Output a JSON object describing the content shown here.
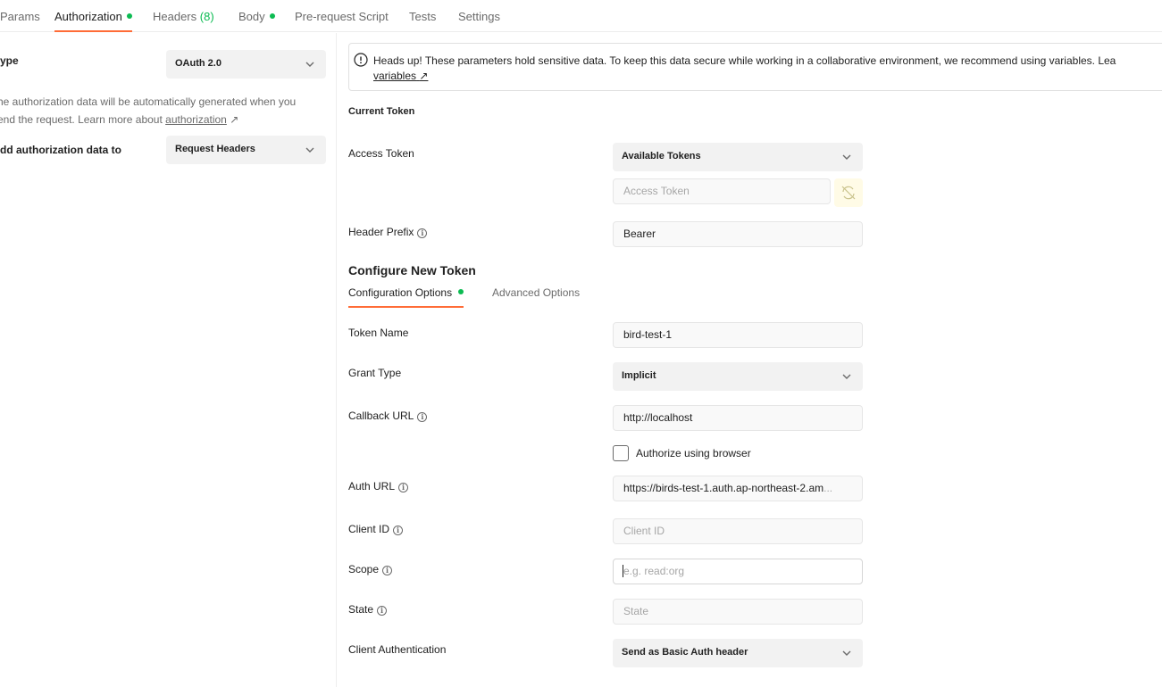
{
  "tabs": [
    {
      "label": "Params"
    },
    {
      "label": "Authorization"
    },
    {
      "label": "Headers",
      "count": "(8)"
    },
    {
      "label": "Body"
    },
    {
      "label": "Pre-request Script"
    },
    {
      "label": "Tests"
    },
    {
      "label": "Settings"
    }
  ],
  "left": {
    "type_label": "ype",
    "type_value": "OAuth 2.0",
    "description_line1": "he authorization data will be automatically generated when you",
    "description_line2_prefix": "end the request. Learn more about ",
    "description_link": "authorization",
    "description_link_arrow": "↗",
    "add_to_label": "dd authorization data to",
    "add_to_value": "Request Headers"
  },
  "alert": {
    "text": "Heads up! These parameters hold sensitive data. To keep this data secure while working in a collaborative environment, we recommend using variables. Lea",
    "link": "variables",
    "link_arrow": "↗"
  },
  "current_token": {
    "title": "Current Token",
    "access_token_label": "Access Token",
    "available_tokens": "Available Tokens",
    "access_token_placeholder": "Access Token",
    "header_prefix_label": "Header Prefix",
    "header_prefix_value": "Bearer"
  },
  "configure": {
    "title": "Configure New Token",
    "tab_config": "Configuration Options",
    "tab_advanced": "Advanced Options",
    "token_name_label": "Token Name",
    "token_name_value": "bird-test-1",
    "grant_type_label": "Grant Type",
    "grant_type_value": "Implicit",
    "callback_url_label": "Callback URL",
    "callback_url_value": "http://localhost",
    "authorize_browser_label": "Authorize using browser",
    "auth_url_label": "Auth URL",
    "auth_url_value": "https://birds-test-1.auth.ap-northeast-2.am",
    "auth_url_ellipsis": "...",
    "client_id_label": "Client ID",
    "client_id_placeholder": "Client ID",
    "scope_label": "Scope",
    "scope_placeholder": "e.g. read:org",
    "state_label": "State",
    "state_placeholder": "State",
    "client_auth_label": "Client Authentication",
    "client_auth_value": "Send as Basic Auth header"
  },
  "colors": {
    "accent": "#ff6c37",
    "status_green": "#0cbb52"
  },
  "icons": {
    "chevron": "chevron-down-icon",
    "info": "info-icon",
    "sync": "sync-disabled-icon",
    "alert": "alert-info-icon"
  }
}
